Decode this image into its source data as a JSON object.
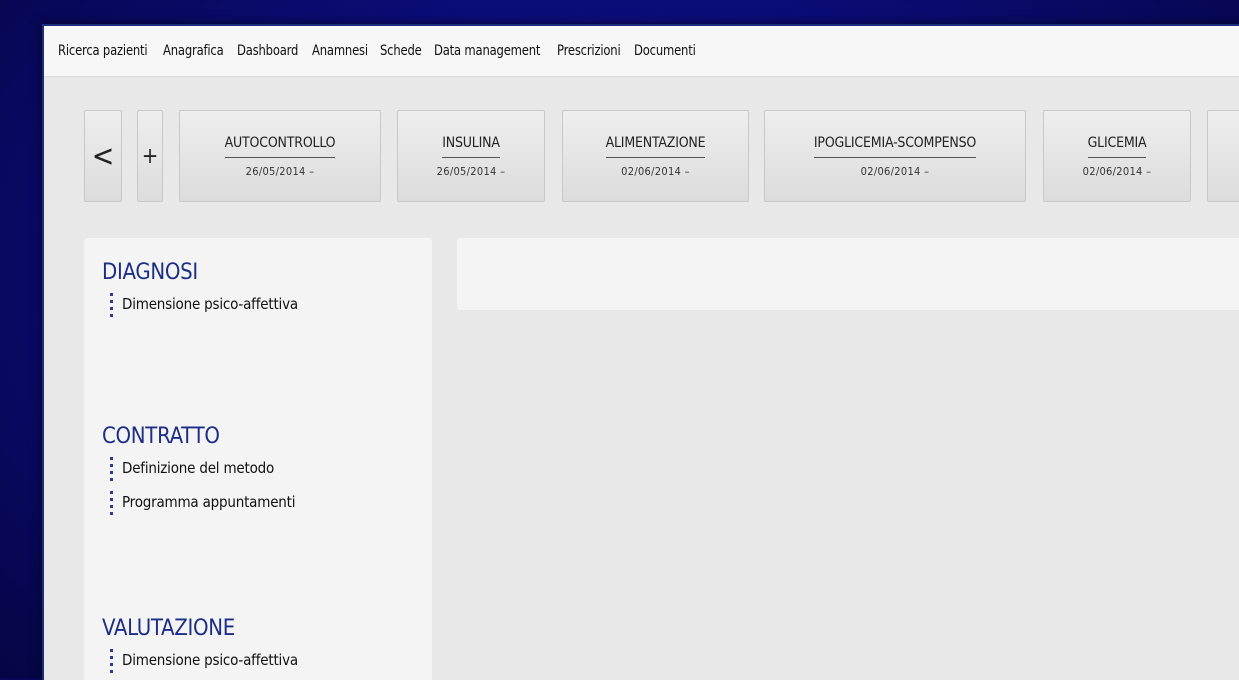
{
  "menu": [
    "Ricerca pazienti",
    "Anagrafica",
    "Dashboard",
    "Anamnesi",
    "Schede",
    "Data management",
    "Prescrizioni",
    "Documenti"
  ],
  "nav": {
    "back": "<",
    "add": "+"
  },
  "cards": [
    {
      "title": "AUTOCONTROLLO",
      "date": "26/05/2014 –"
    },
    {
      "title": "INSULINA",
      "date": "26/05/2014 –"
    },
    {
      "title": "ALIMENTAZIONE",
      "date": "02/06/2014 –"
    },
    {
      "title": "IPOGLICEMIA-SCOMPENSO",
      "date": "02/06/2014 –"
    },
    {
      "title": "GLICEMIA",
      "date": "02/06/2014 –"
    }
  ],
  "sidebar": {
    "sections": [
      {
        "title": "DIAGNOSI",
        "items": [
          "Dimensione psico-affettiva"
        ]
      },
      {
        "title": "CONTRATTO",
        "items": [
          "Definizione del metodo",
          "Programma appuntamenti"
        ]
      },
      {
        "title": "VALUTAZIONE",
        "items": [
          "Dimensione psico-affettiva"
        ]
      }
    ]
  }
}
